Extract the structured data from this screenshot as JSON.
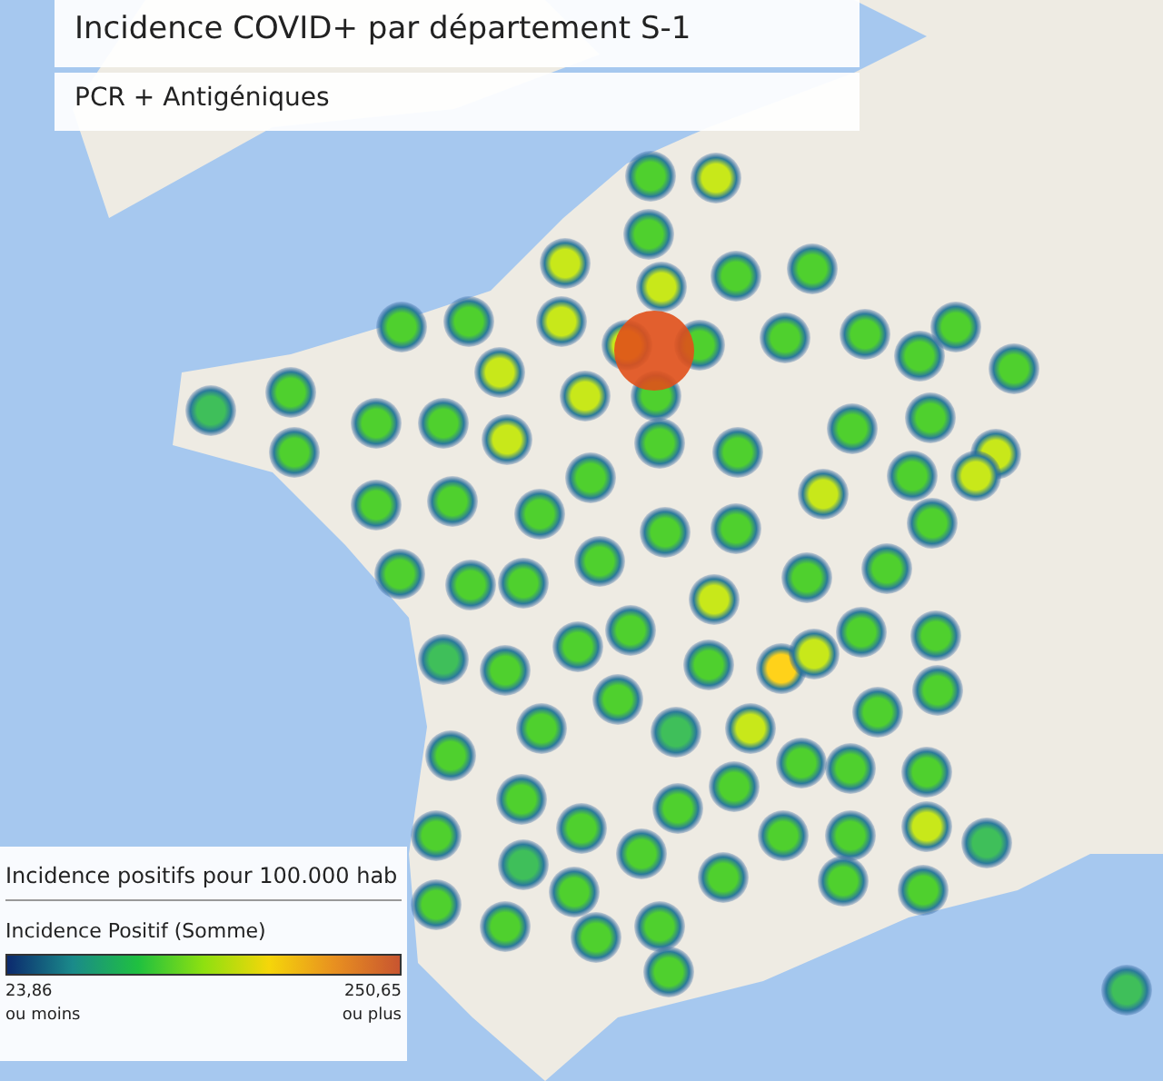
{
  "title": "Incidence COVID+ par département S-1",
  "subtitle": "PCR + Antigéniques",
  "legend": {
    "title": "Incidence positifs pour 100.000 hab",
    "measure": "Incidence Positif (Somme)",
    "min_value": "23,86",
    "min_note": "ou moins",
    "max_value": "250,65",
    "max_note": "ou plus"
  }
}
